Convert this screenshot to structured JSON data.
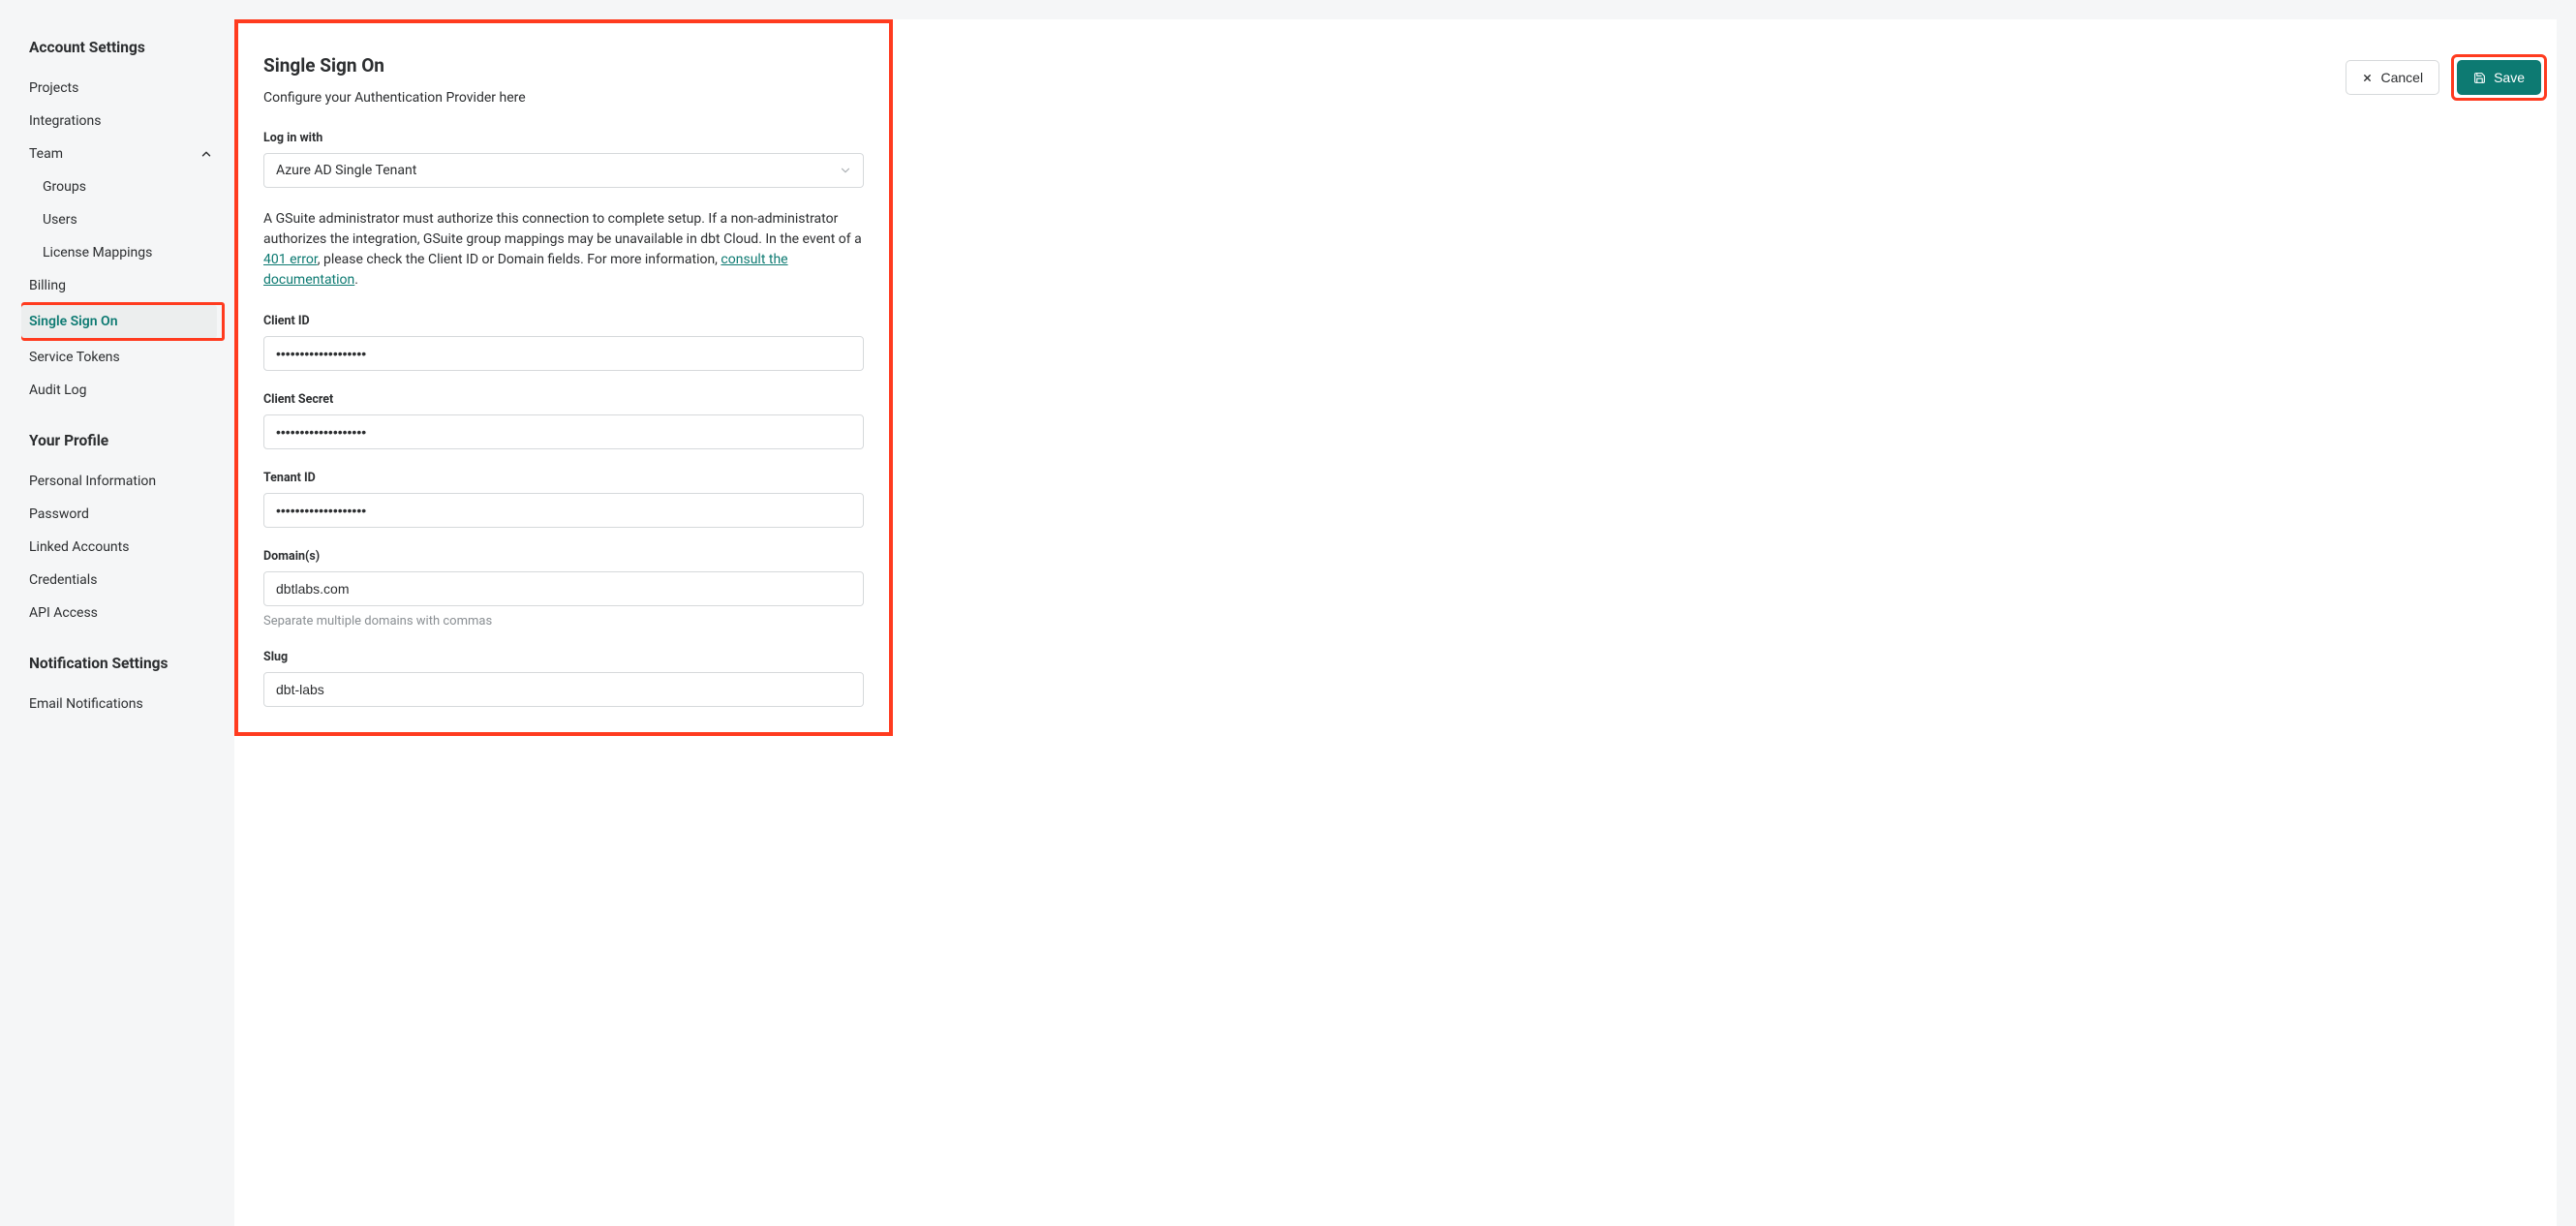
{
  "sidebar": {
    "accountSettings": {
      "title": "Account Settings",
      "items": {
        "projects": "Projects",
        "integrations": "Integrations",
        "team": "Team",
        "groups": "Groups",
        "users": "Users",
        "licenseMappings": "License Mappings",
        "billing": "Billing",
        "sso": "Single Sign On",
        "serviceTokens": "Service Tokens",
        "auditLog": "Audit Log"
      }
    },
    "yourProfile": {
      "title": "Your Profile",
      "items": {
        "personalInfo": "Personal Information",
        "password": "Password",
        "linkedAccounts": "Linked Accounts",
        "credentials": "Credentials",
        "apiAccess": "API Access"
      }
    },
    "notificationSettings": {
      "title": "Notification Settings",
      "items": {
        "emailNotifications": "Email Notifications"
      }
    }
  },
  "actions": {
    "cancel": "Cancel",
    "save": "Save"
  },
  "form": {
    "title": "Single Sign On",
    "subtitle": "Configure your Authentication Provider here",
    "loginWith": {
      "label": "Log in with",
      "value": "Azure AD Single Tenant"
    },
    "info": {
      "part1": "A GSuite administrator must authorize this connection to complete setup. If a non-administrator authorizes the integration, GSuite group mappings may be unavailable in dbt Cloud. In the event of a ",
      "link1": "401 error",
      "part2": ", please check the Client ID or Domain fields. For more information, ",
      "link2": "consult the documentation",
      "part3": "."
    },
    "clientId": {
      "label": "Client ID",
      "value": "•••••••••••••••••••"
    },
    "clientSecret": {
      "label": "Client Secret",
      "value": "•••••••••••••••••••"
    },
    "tenantId": {
      "label": "Tenant ID",
      "value": "•••••••••••••••••••"
    },
    "domains": {
      "label": "Domain(s)",
      "value": "dbtlabs.com",
      "help": "Separate multiple domains with commas"
    },
    "slug": {
      "label": "Slug",
      "value": "dbt-labs"
    }
  }
}
